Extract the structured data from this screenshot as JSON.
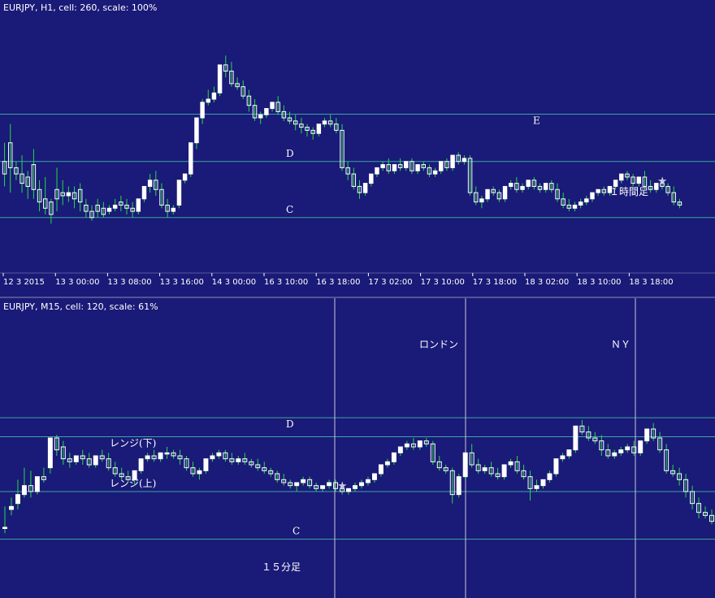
{
  "colors": {
    "background": "#1a1a78",
    "level_line": "#3aa6a0",
    "session_line": "#c8c8d8",
    "candle_bull": "#ffffff",
    "candle_bear": "#ffffff",
    "wick": "#22dd44",
    "text": "#ffffff",
    "star": "#c8c8dc"
  },
  "chart_data": [
    {
      "type": "candlestick",
      "title": "EURJPY, H1, cell: 260, scale: 100%",
      "timeframe_label": "１時間足",
      "x_tick_labels": [
        "12 3 2015",
        "13 3 00:00",
        "13 3 08:00",
        "13 3 16:00",
        "14 3 00:00",
        "16 3 10:00",
        "16 3 18:00",
        "17 3 02:00",
        "17 3 10:00",
        "17 3 18:00",
        "18 3 02:00",
        "18 3 10:00",
        "18 3 18:00"
      ],
      "levels": [
        {
          "label": "C",
          "value": 30
        },
        {
          "label": "D",
          "value": 120
        },
        {
          "label": "E",
          "value": 196
        }
      ],
      "marker_label": "★",
      "marker_index": 113,
      "ylim": [
        340,
        -12
      ],
      "candles": [
        [
          120,
          150,
          100,
          80
        ],
        [
          150,
          180,
          110,
          70
        ],
        [
          110,
          120,
          100,
          90
        ],
        [
          100,
          130,
          85,
          70
        ],
        [
          95,
          105,
          80,
          60
        ],
        [
          115,
          140,
          75,
          60
        ],
        [
          75,
          90,
          55,
          40
        ],
        [
          60,
          95,
          45,
          35
        ],
        [
          55,
          60,
          35,
          20
        ],
        [
          75,
          110,
          60,
          40
        ],
        [
          70,
          90,
          65,
          50
        ],
        [
          65,
          80,
          70,
          55
        ],
        [
          70,
          80,
          60,
          45
        ],
        [
          75,
          85,
          55,
          40
        ],
        [
          50,
          60,
          40,
          30
        ],
        [
          40,
          50,
          30,
          25
        ],
        [
          50,
          60,
          40,
          30
        ],
        [
          45,
          55,
          35,
          30
        ],
        [
          40,
          50,
          45,
          35
        ],
        [
          45,
          60,
          50,
          40
        ],
        [
          55,
          65,
          50,
          40
        ],
        [
          50,
          60,
          45,
          35
        ],
        [
          45,
          55,
          40,
          30
        ],
        [
          40,
          50,
          60,
          35
        ],
        [
          60,
          70,
          80,
          55
        ],
        [
          80,
          100,
          90,
          70
        ],
        [
          90,
          105,
          75,
          65
        ],
        [
          75,
          85,
          50,
          45
        ],
        [
          50,
          60,
          40,
          30
        ],
        [
          40,
          50,
          45,
          35
        ],
        [
          50,
          60,
          90,
          45
        ],
        [
          90,
          100,
          100,
          85
        ],
        [
          100,
          110,
          150,
          95
        ],
        [
          150,
          170,
          190,
          140
        ],
        [
          190,
          220,
          215,
          180
        ],
        [
          215,
          235,
          220,
          210
        ],
        [
          220,
          240,
          230,
          215
        ],
        [
          230,
          255,
          275,
          225
        ],
        [
          275,
          290,
          265,
          255
        ],
        [
          265,
          280,
          245,
          240
        ],
        [
          245,
          255,
          240,
          235
        ],
        [
          240,
          250,
          225,
          220
        ],
        [
          225,
          235,
          210,
          200
        ],
        [
          210,
          220,
          190,
          185
        ],
        [
          190,
          200,
          195,
          180
        ],
        [
          195,
          205,
          205,
          190
        ],
        [
          205,
          215,
          215,
          200
        ],
        [
          215,
          225,
          200,
          195
        ],
        [
          200,
          210,
          190,
          185
        ],
        [
          190,
          200,
          185,
          180
        ],
        [
          185,
          195,
          180,
          170
        ],
        [
          180,
          190,
          175,
          165
        ],
        [
          175,
          180,
          170,
          160
        ],
        [
          170,
          175,
          165,
          155
        ],
        [
          165,
          170,
          180,
          160
        ],
        [
          180,
          190,
          185,
          175
        ],
        [
          185,
          195,
          180,
          175
        ],
        [
          180,
          190,
          170,
          165
        ],
        [
          170,
          180,
          110,
          105
        ],
        [
          110,
          120,
          100,
          90
        ],
        [
          100,
          110,
          80,
          75
        ],
        [
          80,
          90,
          70,
          60
        ],
        [
          70,
          80,
          85,
          65
        ],
        [
          85,
          95,
          100,
          80
        ],
        [
          100,
          110,
          110,
          95
        ],
        [
          110,
          120,
          115,
          105
        ],
        [
          115,
          125,
          105,
          100
        ],
        [
          105,
          115,
          115,
          100
        ],
        [
          115,
          125,
          110,
          105
        ],
        [
          110,
          120,
          120,
          105
        ],
        [
          120,
          125,
          105,
          100
        ],
        [
          105,
          115,
          115,
          100
        ],
        [
          115,
          120,
          110,
          105
        ],
        [
          110,
          115,
          100,
          95
        ],
        [
          100,
          110,
          105,
          95
        ],
        [
          105,
          115,
          120,
          100
        ],
        [
          120,
          125,
          110,
          105
        ],
        [
          110,
          120,
          130,
          105
        ],
        [
          130,
          135,
          120,
          115
        ],
        [
          120,
          130,
          125,
          115
        ],
        [
          125,
          130,
          70,
          65
        ],
        [
          70,
          80,
          55,
          50
        ],
        [
          55,
          65,
          60,
          45
        ],
        [
          60,
          70,
          75,
          55
        ],
        [
          75,
          80,
          70,
          65
        ],
        [
          70,
          75,
          60,
          55
        ],
        [
          60,
          70,
          80,
          55
        ],
        [
          80,
          90,
          85,
          75
        ],
        [
          85,
          95,
          75,
          70
        ],
        [
          75,
          85,
          80,
          70
        ],
        [
          80,
          90,
          90,
          75
        ],
        [
          90,
          95,
          80,
          75
        ],
        [
          80,
          85,
          75,
          70
        ],
        [
          75,
          80,
          85,
          70
        ],
        [
          85,
          90,
          75,
          70
        ],
        [
          75,
          85,
          60,
          55
        ],
        [
          60,
          70,
          50,
          45
        ],
        [
          50,
          60,
          45,
          40
        ],
        [
          45,
          55,
          50,
          40
        ],
        [
          50,
          60,
          55,
          45
        ],
        [
          55,
          65,
          60,
          50
        ],
        [
          60,
          70,
          70,
          55
        ],
        [
          70,
          75,
          75,
          65
        ],
        [
          75,
          80,
          70,
          65
        ],
        [
          70,
          75,
          80,
          65
        ],
        [
          80,
          90,
          90,
          75
        ],
        [
          90,
          100,
          100,
          85
        ],
        [
          100,
          105,
          95,
          90
        ],
        [
          95,
          100,
          85,
          80
        ],
        [
          85,
          95,
          95,
          80
        ],
        [
          95,
          105,
          80,
          75
        ],
        [
          80,
          90,
          75,
          70
        ],
        [
          75,
          80,
          85,
          70
        ],
        [
          85,
          90,
          80,
          75
        ],
        [
          80,
          85,
          70,
          65
        ],
        [
          70,
          80,
          55,
          50
        ],
        [
          55,
          60,
          50,
          45
        ]
      ]
    },
    {
      "type": "candlestick",
      "title": "EURJPY, M15, cell: 120, scale: 61%",
      "timeframe_label": "１５分足",
      "levels": [
        {
          "label": "C",
          "value": 60
        },
        {
          "label": "レンジ(上)",
          "value": 140
        },
        {
          "label": "レンジ(下)",
          "value": 232
        },
        {
          "label": "D",
          "value": 264
        }
      ],
      "session_labels": [
        "ロンドン",
        "ＮＹ"
      ],
      "marker_label": "★",
      "marker_index": 52,
      "ylim": [
        365,
        65
      ],
      "candles": [
        [
          80,
          115,
          80,
          70
        ],
        [
          110,
          130,
          115,
          100
        ],
        [
          120,
          160,
          135,
          110
        ],
        [
          135,
          180,
          150,
          130
        ],
        [
          150,
          175,
          140,
          130
        ],
        [
          140,
          160,
          165,
          135
        ],
        [
          165,
          180,
          160,
          155
        ],
        [
          180,
          225,
          230,
          170
        ],
        [
          230,
          235,
          210,
          200
        ],
        [
          215,
          225,
          195,
          185
        ],
        [
          195,
          205,
          190,
          180
        ],
        [
          190,
          200,
          200,
          185
        ],
        [
          200,
          210,
          195,
          185
        ],
        [
          195,
          205,
          185,
          180
        ],
        [
          185,
          200,
          200,
          180
        ],
        [
          200,
          210,
          195,
          190
        ],
        [
          195,
          205,
          180,
          175
        ],
        [
          180,
          190,
          170,
          165
        ],
        [
          170,
          180,
          165,
          160
        ],
        [
          165,
          175,
          160,
          155
        ],
        [
          160,
          175,
          175,
          150
        ],
        [
          175,
          190,
          195,
          170
        ],
        [
          195,
          205,
          200,
          190
        ],
        [
          200,
          210,
          195,
          190
        ],
        [
          195,
          205,
          205,
          190
        ],
        [
          205,
          215,
          205,
          195
        ],
        [
          205,
          210,
          200,
          195
        ],
        [
          200,
          210,
          195,
          185
        ],
        [
          195,
          200,
          180,
          175
        ],
        [
          180,
          190,
          170,
          165
        ],
        [
          170,
          180,
          175,
          160
        ],
        [
          175,
          190,
          195,
          170
        ],
        [
          195,
          205,
          200,
          190
        ],
        [
          200,
          210,
          205,
          195
        ],
        [
          205,
          210,
          195,
          190
        ],
        [
          195,
          205,
          190,
          185
        ],
        [
          190,
          200,
          195,
          185
        ],
        [
          195,
          205,
          190,
          185
        ],
        [
          190,
          195,
          185,
          180
        ],
        [
          185,
          195,
          180,
          175
        ],
        [
          180,
          190,
          175,
          170
        ],
        [
          175,
          180,
          170,
          165
        ],
        [
          170,
          175,
          160,
          155
        ],
        [
          160,
          170,
          155,
          150
        ],
        [
          155,
          160,
          150,
          145
        ],
        [
          150,
          155,
          155,
          140
        ],
        [
          155,
          165,
          160,
          150
        ],
        [
          160,
          165,
          150,
          145
        ],
        [
          150,
          155,
          145,
          140
        ],
        [
          145,
          150,
          150,
          140
        ],
        [
          150,
          160,
          155,
          145
        ],
        [
          155,
          160,
          145,
          140
        ],
        [
          145,
          150,
          140,
          135
        ],
        [
          140,
          145,
          145,
          135
        ],
        [
          145,
          155,
          150,
          140
        ],
        [
          150,
          160,
          155,
          145
        ],
        [
          155,
          165,
          160,
          150
        ],
        [
          160,
          170,
          170,
          155
        ],
        [
          170,
          180,
          185,
          165
        ],
        [
          185,
          195,
          190,
          180
        ],
        [
          190,
          200,
          205,
          185
        ],
        [
          205,
          215,
          215,
          200
        ],
        [
          215,
          225,
          220,
          210
        ],
        [
          220,
          230,
          215,
          210
        ],
        [
          215,
          225,
          225,
          210
        ],
        [
          225,
          230,
          220,
          215
        ],
        [
          220,
          225,
          190,
          185
        ],
        [
          190,
          200,
          180,
          175
        ],
        [
          180,
          185,
          175,
          170
        ],
        [
          175,
          180,
          135,
          120
        ],
        [
          135,
          170,
          165,
          130
        ],
        [
          165,
          180,
          205,
          160
        ],
        [
          205,
          220,
          185,
          180
        ],
        [
          185,
          195,
          175,
          170
        ],
        [
          175,
          185,
          180,
          170
        ],
        [
          180,
          190,
          170,
          165
        ],
        [
          170,
          180,
          165,
          160
        ],
        [
          165,
          175,
          185,
          160
        ],
        [
          185,
          195,
          190,
          180
        ],
        [
          190,
          200,
          175,
          170
        ],
        [
          175,
          185,
          165,
          160
        ],
        [
          165,
          175,
          145,
          125
        ],
        [
          145,
          160,
          150,
          140
        ],
        [
          150,
          160,
          160,
          145
        ],
        [
          160,
          175,
          170,
          155
        ],
        [
          170,
          185,
          195,
          165
        ],
        [
          195,
          205,
          200,
          190
        ],
        [
          200,
          210,
          210,
          195
        ],
        [
          210,
          235,
          250,
          205
        ],
        [
          250,
          260,
          240,
          235
        ],
        [
          240,
          250,
          230,
          225
        ],
        [
          230,
          240,
          225,
          220
        ],
        [
          225,
          235,
          210,
          200
        ],
        [
          210,
          220,
          200,
          195
        ],
        [
          200,
          210,
          205,
          195
        ],
        [
          205,
          215,
          210,
          200
        ],
        [
          210,
          220,
          215,
          205
        ],
        [
          215,
          225,
          205,
          200
        ],
        [
          205,
          215,
          225,
          200
        ],
        [
          225,
          240,
          245,
          220
        ],
        [
          245,
          255,
          230,
          225
        ],
        [
          230,
          240,
          210,
          205
        ],
        [
          210,
          220,
          175,
          170
        ],
        [
          175,
          185,
          170,
          165
        ],
        [
          170,
          180,
          160,
          150
        ],
        [
          160,
          170,
          140,
          130
        ],
        [
          140,
          150,
          120,
          110
        ],
        [
          120,
          130,
          105,
          95
        ],
        [
          105,
          115,
          100,
          95
        ],
        [
          100,
          110,
          90,
          85
        ]
      ]
    }
  ]
}
